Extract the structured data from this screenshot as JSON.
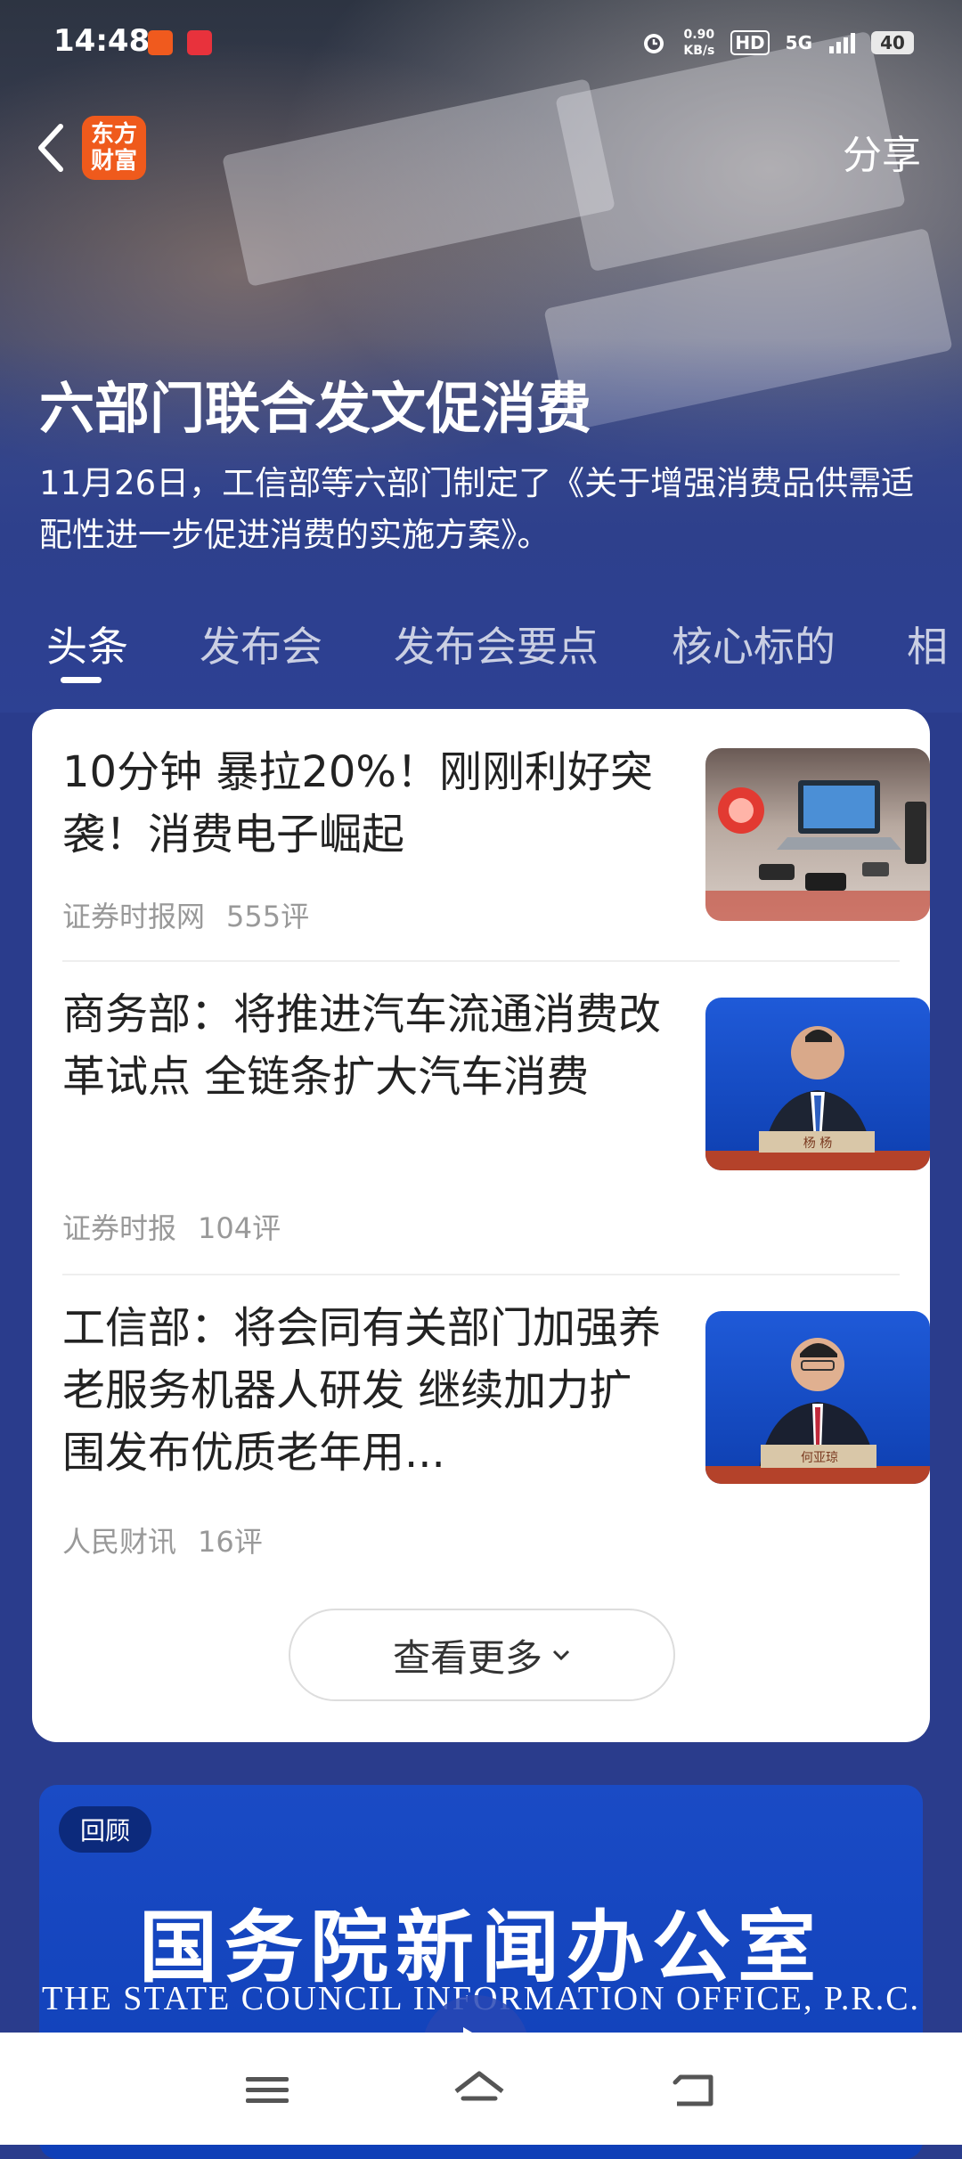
{
  "status_bar": {
    "time": "14:48",
    "net_speed_value": "0.90",
    "net_speed_unit": "KB/s",
    "hd": "HD",
    "network": "5G",
    "battery": "40"
  },
  "header": {
    "logo_line1": "东方",
    "logo_line2": "财富",
    "share_label": "分享"
  },
  "hero": {
    "title": "六部门联合发文促消费",
    "subtitle": "11月26日，工信部等六部门制定了《关于增强消费品供需适配性进一步促进消费的实施方案》。"
  },
  "tabs": [
    {
      "label": "头条",
      "active": true
    },
    {
      "label": "发布会",
      "active": false
    },
    {
      "label": "发布会要点",
      "active": false
    },
    {
      "label": "核心标的",
      "active": false
    },
    {
      "label": "相",
      "active": false
    }
  ],
  "news": [
    {
      "title": "10分钟 暴拉20%！刚刚利好突袭！消费电子崛起",
      "source": "证券时报网",
      "comments": "555评",
      "thumb_caption": ""
    },
    {
      "title": "商务部：将推进汽车流通消费改革试点 全链条扩大汽车消费",
      "source": "证券时报",
      "comments": "104评",
      "thumb_caption": "杨 杨"
    },
    {
      "title": "工信部：将会同有关部门加强养老服务机器人研发 继续加力扩围发布优质老年用...",
      "source": "人民财讯",
      "comments": "16评",
      "thumb_caption": "何亚琼"
    }
  ],
  "more_button": "查看更多",
  "video": {
    "badge": "回顾",
    "title_cn": "国务院新闻办公室",
    "title_en": "THE STATE COUNCIL INFORMATION OFFICE, P.R.C."
  },
  "colors": {
    "brand_orange": "#ef5a1c",
    "page_blue": "#2d4193"
  },
  "icons": [
    "back-arrow-icon",
    "menu-icon",
    "home-icon",
    "back-icon",
    "chevron-down-icon",
    "play-icon",
    "alarm-icon"
  ]
}
